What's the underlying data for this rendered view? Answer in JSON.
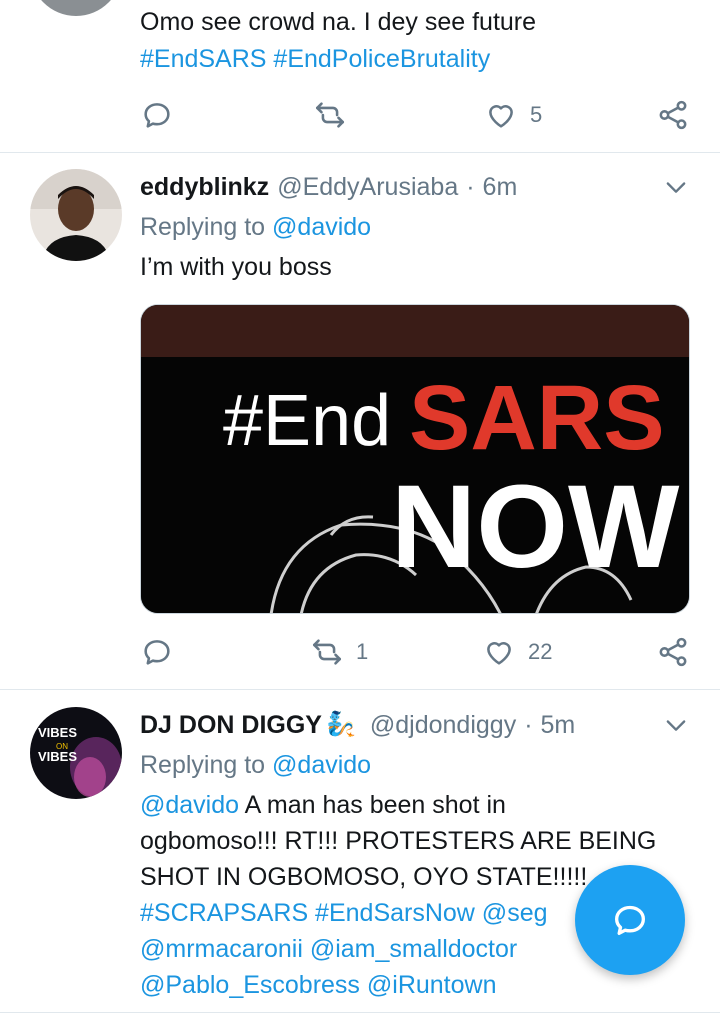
{
  "colors": {
    "accent": "#1b95e0",
    "muted": "#657786",
    "fab": "#1da1f2"
  },
  "top_tweet": {
    "line1": "Omo see crowd na. I dey see future",
    "hashtags": "#EndSARS #EndPoliceBrutality",
    "like_count": "5"
  },
  "tweet1": {
    "name": "eddyblinkz",
    "handle": "@EddyArusiaba",
    "time": "6m",
    "replying_prefix": "Replying to",
    "replying_to": "@davido",
    "text": "I’m with you boss",
    "media": {
      "hash": "#End",
      "sars": "SARS",
      "now": "NOW"
    },
    "retweet_count": "1",
    "like_count": "22"
  },
  "tweet2": {
    "name": "DJ DON DIGGY",
    "emoji": "🧞",
    "handle": "@djdondiggy",
    "time": "5m",
    "replying_prefix": "Replying to",
    "replying_to": "@davido",
    "mention": "@davido",
    "line1_rest": " A man has been shot in",
    "line2": "ogbomoso!!! RT!!! PROTESTERS ARE BEING",
    "line3": "SHOT IN OGBOMOSO, OYO STATE!!!!!",
    "line4": "#SCRAPSARS #EndSarsNow @seg",
    "line5": "@mrmacaronii @iam_smalldoctor",
    "line6": "@Pablo_Escobress @iRuntown",
    "avatar_text": {
      "top": "VIBES",
      "mid": "ON",
      "bottom": "VIBES"
    }
  },
  "icons": [
    "reply-icon",
    "retweet-icon",
    "like-icon",
    "share-icon",
    "chevron-down-icon",
    "compose-reply-icon"
  ]
}
